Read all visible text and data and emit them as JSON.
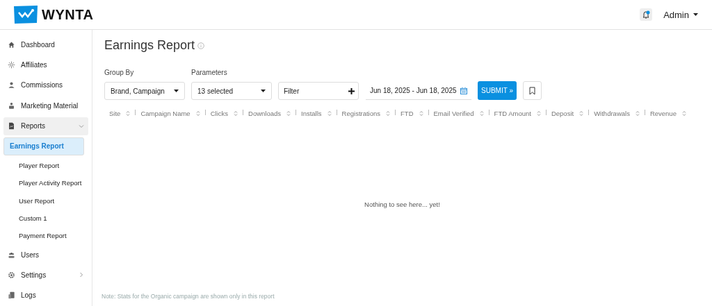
{
  "header": {
    "logo_text": "WYNTA",
    "notifications": {
      "unread": true
    },
    "user_menu": "Admin"
  },
  "sidebar": {
    "items": [
      {
        "label": "Dashboard",
        "selected": false
      },
      {
        "label": "Affiliates",
        "selected": false
      },
      {
        "label": "Commissions",
        "selected": false
      },
      {
        "label": "Marketing Material",
        "selected": false
      },
      {
        "label": "Reports",
        "selected": false,
        "expanded": true,
        "children": [
          {
            "label": "Earnings Report",
            "selected": true
          },
          {
            "label": "Player Report",
            "selected": false
          },
          {
            "label": "Player Activity Report",
            "selected": false
          },
          {
            "label": "User Report",
            "selected": false
          },
          {
            "label": "Custom 1",
            "selected": false
          },
          {
            "label": "Payment Report",
            "selected": false
          }
        ]
      },
      {
        "label": "Users",
        "selected": false
      },
      {
        "label": "Settings",
        "selected": false,
        "expanded": false
      },
      {
        "label": "Logs",
        "selected": false
      }
    ]
  },
  "page": {
    "title": "Earnings Report",
    "filters": {
      "group_by": {
        "label": "Group By",
        "value": "Brand, Campaign"
      },
      "parameters": {
        "label": "Parameters",
        "value": "13 selected"
      },
      "filter": {
        "placeholder": "Filter"
      },
      "date_range": "Jun 18, 2025 - Jun 18, 2025",
      "submit": "SUBMIT »"
    },
    "table": {
      "columns": [
        "Site",
        "Campaign Name",
        "Clicks",
        "Downloads",
        "Installs",
        "Registrations",
        "FTD",
        "Email Verified",
        "FTD Amount",
        "Deposit",
        "Withdrawals",
        "Revenue"
      ],
      "empty_message": "Nothing to see here... yet!"
    },
    "note": "Note: Stats for the Organic campaign are shown only in this report"
  }
}
